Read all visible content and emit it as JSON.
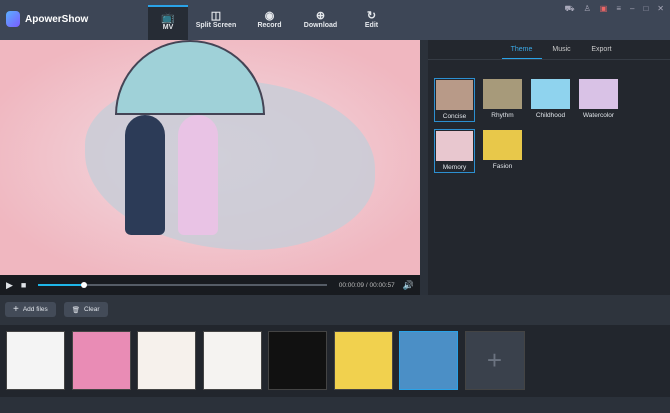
{
  "app": {
    "title": "ApowerShow"
  },
  "nav": [
    {
      "label": "MV",
      "icon": "tv-icon"
    },
    {
      "label": "Split Screen",
      "icon": "layout-icon"
    },
    {
      "label": "Record",
      "icon": "record-icon"
    },
    {
      "label": "Download",
      "icon": "download-icon"
    },
    {
      "label": "Edit",
      "icon": "refresh-icon"
    }
  ],
  "player": {
    "time": "00:00:09 / 00:00:57",
    "progress": 0.158
  },
  "panel": {
    "tabs": [
      "Theme",
      "Music",
      "Export"
    ],
    "active_tab": "Theme",
    "themes": [
      {
        "label": "Concise",
        "color": "#b89a88"
      },
      {
        "label": "Rhythm",
        "color": "#a79a7a"
      },
      {
        "label": "Childhood",
        "color": "#8fd3ee"
      },
      {
        "label": "Watercolor",
        "color": "#d9c2e6"
      },
      {
        "label": "Memory",
        "color": "#e8c7cf"
      },
      {
        "label": "Fasion",
        "color": "#e8c84a"
      }
    ],
    "selected": [
      "Concise",
      "Memory"
    ]
  },
  "toolbar": {
    "add_files": "Add files",
    "clear": "Clear"
  },
  "clips": [
    "#f4f4f4",
    "#e98cb5",
    "#f6f1ec",
    "#f5f3f1",
    "#111111",
    "#f1d14e",
    "#4b8fc6"
  ],
  "colors": {
    "accent": "#2aa3e8",
    "header": "#3d4656"
  }
}
